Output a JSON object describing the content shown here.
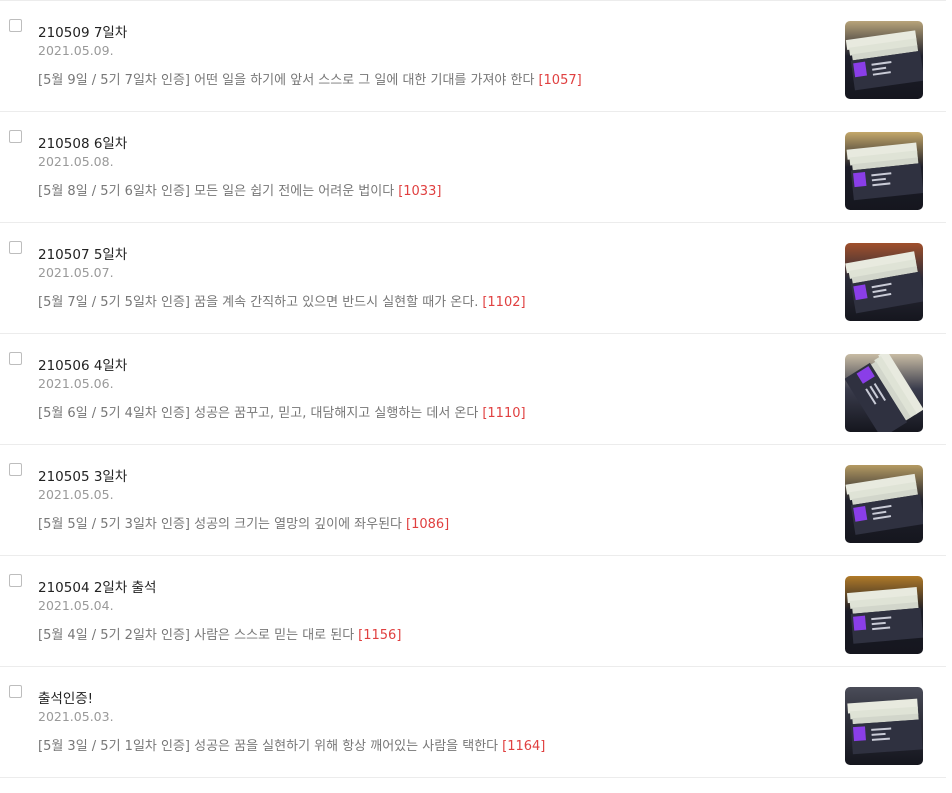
{
  "posts": [
    {
      "title": "210509 7일차",
      "date": "2021.05.09.",
      "summary": "[5월 9일 / 5기 7일차 인증] 어떤 일을 하기에 앞서 스스로 그 일에 대한 기대를 가져야 한다",
      "count": "[1057]",
      "thumb_top": "#b8a47a",
      "thumb_bottom": "#1e1f2b",
      "thumb_rotate": -8
    },
    {
      "title": "210508 6일차",
      "date": "2021.05.08.",
      "summary": "[5월 8일 / 5기 6일차 인증] 모든 일은 쉽기 전에는 어려운 법이다",
      "count": "[1033]",
      "thumb_top": "#c4a86a",
      "thumb_bottom": "#1c1d28",
      "thumb_rotate": -6
    },
    {
      "title": "210507 5일차",
      "date": "2021.05.07.",
      "summary": "[5월 7일 / 5기 5일차 인증] 꿈을 계속 간직하고 있으면 반드시 실현할 때가 온다.",
      "count": "[1102]",
      "thumb_top": "#a0502c",
      "thumb_bottom": "#2a2b38",
      "thumb_rotate": -10
    },
    {
      "title": "210506 4일차",
      "date": "2021.05.06.",
      "summary": "[5월 6일 / 5기 4일차 인증] 성공은 꿈꾸고, 믿고, 대담해지고 실행하는 데서 온다",
      "count": "[1110]",
      "thumb_top": "#c8bca4",
      "thumb_bottom": "#3a3c4c",
      "thumb_rotate": 58
    },
    {
      "title": "210505 3일차",
      "date": "2021.05.05.",
      "summary": "[5월 5일 / 5기 3일차 인증] 성공의 크기는 열망의 깊이에 좌우된다",
      "count": "[1086]",
      "thumb_top": "#b49a62",
      "thumb_bottom": "#20212c",
      "thumb_rotate": -9
    },
    {
      "title": "210504 2일차 출석",
      "date": "2021.05.04.",
      "summary": "[5월 4일 / 5기 2일차 인증] 사람은 스스로 믿는 대로 된다",
      "count": "[1156]",
      "thumb_top": "#b07a28",
      "thumb_bottom": "#1a1b26",
      "thumb_rotate": -5
    },
    {
      "title": "출석인증!",
      "date": "2021.05.03.",
      "summary": "[5월 3일 / 5기 1일차 인증] 성공은 꿈을 실현하기 위해 항상 깨어있는 사람을 택한다",
      "count": "[1164]",
      "thumb_top": "#4a4c58",
      "thumb_bottom": "#2c2d38",
      "thumb_rotate": -4
    }
  ],
  "colors": {
    "count": "#e04040",
    "title": "#222222",
    "date": "#999999",
    "summary": "#777777",
    "accent_purple": "#8a3ee8"
  },
  "icons": {
    "checkbox": "checkbox-icon"
  }
}
